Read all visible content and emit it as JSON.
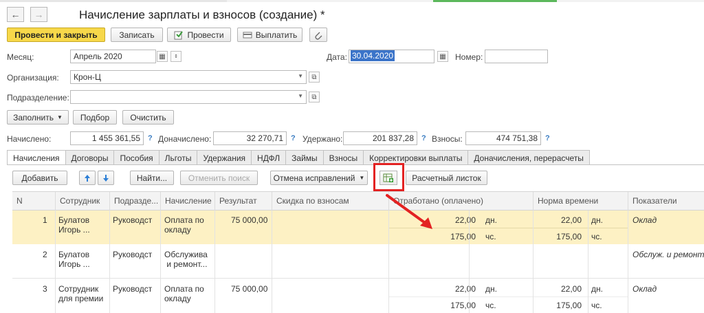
{
  "window": {
    "title": "Начисление зарплаты и взносов (создание) *",
    "back_icon": "←",
    "forward_icon": "→"
  },
  "toolbar": {
    "post_close": "Провести и закрыть",
    "save": "Записать",
    "post": "Провести",
    "pay": "Выплатить"
  },
  "form": {
    "month_label": "Месяц:",
    "month_value": "Апрель 2020",
    "date_label": "Дата:",
    "date_value": "30.04.2020",
    "number_label": "Номер:",
    "number_value": "",
    "org_label": "Организация:",
    "org_value": "Крон-Ц",
    "dept_label": "Подразделение:",
    "dept_value": ""
  },
  "actions": {
    "fill": "Заполнить",
    "select": "Подбор",
    "clear": "Очистить"
  },
  "totals": {
    "accrued_label": "Начислено:",
    "accrued_value": "1 455 361,55",
    "additional_label": "Доначислено:",
    "additional_value": "32 270,71",
    "withheld_label": "Удержано:",
    "withheld_value": "201 837,28",
    "contrib_label": "Взносы:",
    "contrib_value": "474 751,38",
    "help": "?"
  },
  "tabs": [
    "Начисления",
    "Договоры",
    "Пособия",
    "Льготы",
    "Удержания",
    "НДФЛ",
    "Займы",
    "Взносы",
    "Корректировки выплаты",
    "Доначисления, перерасчеты"
  ],
  "grid_toolbar": {
    "add": "Добавить",
    "find": "Найти...",
    "cancel_search": "Отменить поиск",
    "cancel_fixes": "Отмена исправлений",
    "payslip": "Расчетный листок"
  },
  "columns": [
    "N",
    "Сотрудник",
    "Подразде...",
    "Начисление",
    "Результат",
    "Скидка по взносам",
    "Отработано (оплачено)",
    "Норма времени",
    "Показатели"
  ],
  "rows": [
    {
      "n": "1",
      "employee": "Булатов\nИгорь ...",
      "dept": "Руководст",
      "accrual": "Оплата по\nокладу",
      "result": "75 000,00",
      "worked_days": "22,00",
      "worked_days_unit": "дн.",
      "worked_hours": "175,00",
      "worked_hours_unit": "чс.",
      "norm_days": "22,00",
      "norm_days_unit": "дн.",
      "norm_hours": "175,00",
      "norm_hours_unit": "чс.",
      "indicators": "Оклад"
    },
    {
      "n": "2",
      "employee": "Булатов\nИгорь ...",
      "dept": "Руководст",
      "accrual": "Обслужива\n и ремонт...",
      "result": "",
      "indicators": "Обслуж. и ремонт"
    },
    {
      "n": "3",
      "employee": "Сотрудник\nдля премии",
      "dept": "Руководст",
      "accrual": "Оплата по\nокладу",
      "result": "75 000,00",
      "worked_days": "22,00",
      "worked_days_unit": "дн.",
      "worked_hours": "175,00",
      "worked_hours_unit": "чс.",
      "norm_days": "22,00",
      "norm_days_unit": "дн.",
      "norm_hours": "175,00",
      "norm_hours_unit": "чс.",
      "indicators": "Оклад"
    }
  ],
  "colors": {
    "primary_button": "#f7d84a",
    "selected_row": "#fdf1c4",
    "highlight_box": "#e32222",
    "arrow": "#e32222",
    "date_selection": "#3b74c9"
  }
}
